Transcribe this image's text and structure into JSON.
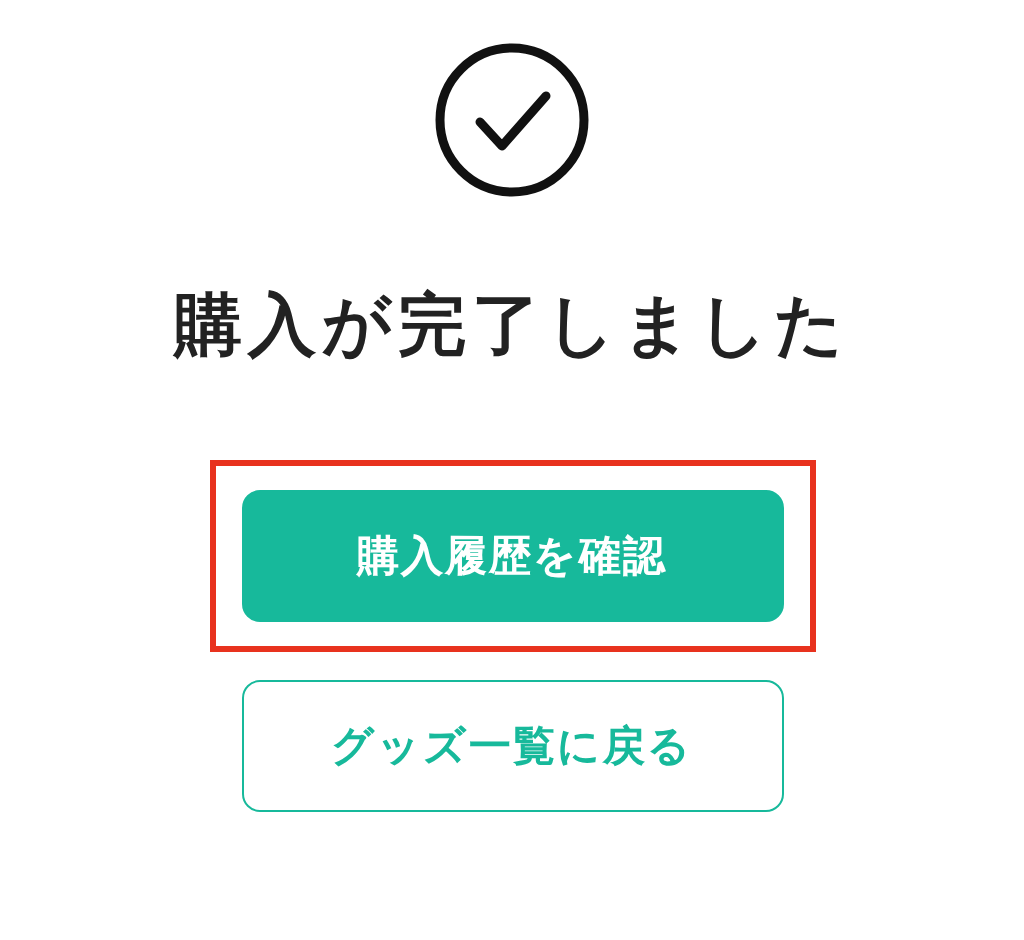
{
  "title": "購入が完了しました",
  "buttons": [
    {
      "label": "購入履歴を確認",
      "kind": "primary",
      "highlighted": true
    },
    {
      "label": "グッズ一覧に戻る",
      "kind": "secondary",
      "highlighted": false
    }
  ]
}
